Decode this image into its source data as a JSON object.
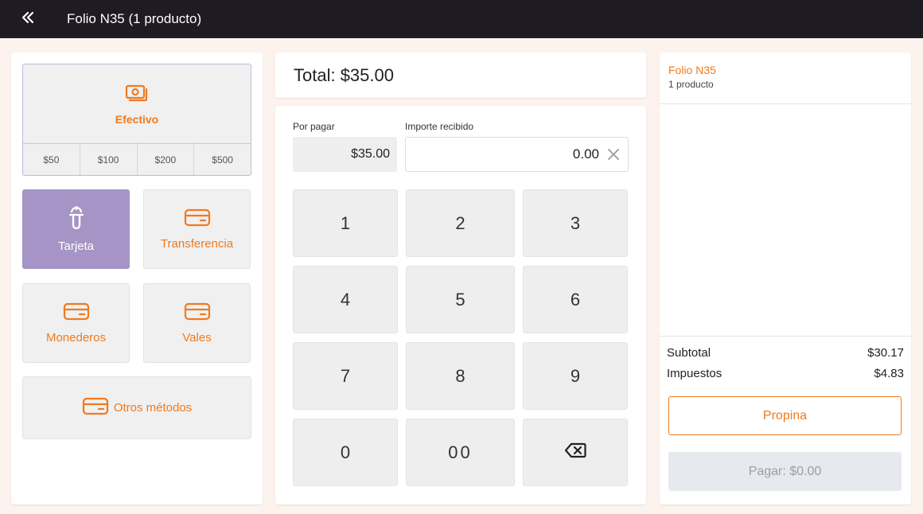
{
  "header": {
    "back_icon": "double-chevron-left-icon",
    "title": "Folio N35 (1 producto)"
  },
  "colors": {
    "accent": "#f07a1e",
    "selected_method": "#a694c6",
    "topbar": "#1f1b22",
    "background": "#fdf3ee"
  },
  "methods": {
    "efectivo": {
      "label": "Efectivo",
      "icon": "cash-icon"
    },
    "bills": [
      "$50",
      "$100",
      "$200",
      "$500"
    ],
    "tarjeta": {
      "label": "Tarjeta",
      "icon": "card-terminal-icon",
      "selected": true
    },
    "transferencia": {
      "label": "Transferencia",
      "icon": "credit-card-icon"
    },
    "monederos": {
      "label": "Monederos",
      "icon": "credit-card-icon"
    },
    "vales": {
      "label": "Vales",
      "icon": "credit-card-icon"
    },
    "otros": {
      "label": "Otros métodos",
      "icon": "credit-card-icon"
    }
  },
  "payment": {
    "total": "Total: $35.00",
    "por_pagar_label": "Por pagar",
    "por_pagar_value": "$35.00",
    "importe_label": "Importe recibido",
    "importe_value": "0.00",
    "clear_icon": "close-icon"
  },
  "keypad": {
    "keys": [
      "1",
      "2",
      "3",
      "4",
      "5",
      "6",
      "7",
      "8",
      "9",
      "0",
      "00"
    ],
    "backspace_icon": "backspace-icon"
  },
  "order": {
    "folio": "Folio N35",
    "items_count": "1 producto",
    "subtotal_label": "Subtotal",
    "subtotal_value": "$30.17",
    "impuestos_label": "Impuestos",
    "impuestos_value": "$4.83",
    "propina_label": "Propina",
    "pagar_label": "Pagar: $0.00"
  }
}
